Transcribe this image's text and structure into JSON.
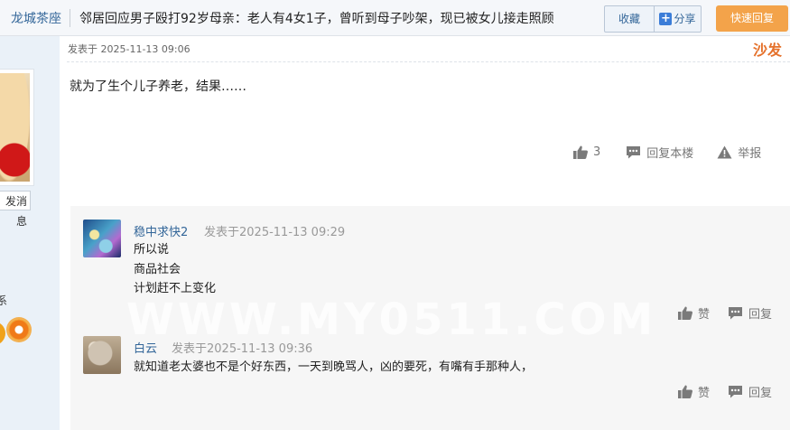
{
  "header": {
    "board_link": "龙城茶座",
    "thread_title": "邻居回应男子殴打92岁母亲：老人有4女1子，曾听到母子吵架，现已被女儿接走照顾",
    "favorite_label": "收藏",
    "share_label": "分享",
    "quick_reply_label": "快速回复"
  },
  "user_sidebar": {
    "message_button": "发消息",
    "text_fragment": "系"
  },
  "post": {
    "posted_at": "发表于 2025-11-13 09:06",
    "floor_label": "沙发",
    "body": "就为了生个儿子养老，结果……",
    "like_count": "3",
    "reply_label": "回复本楼",
    "report_label": "举报"
  },
  "comments": [
    {
      "username": "稳中求快2",
      "posted_at": "发表于2025-11-13 09:29",
      "lines": [
        "所以说",
        "商品社会",
        "计划赶不上变化"
      ],
      "like_label": "赞",
      "reply_label": "回复"
    },
    {
      "username": "白云",
      "posted_at": "发表于2025-11-13 09:36",
      "lines": [
        "就知道老太婆也不是个好东西，一天到晚骂人，凶的要死，有嘴有手那种人，"
      ],
      "like_label": "赞",
      "reply_label": "回复"
    }
  ],
  "watermark": "WWW.MY0511.COM",
  "colors": {
    "link": "#336699",
    "accent_orange": "#f3a34a",
    "floor_label": "#e5712b",
    "comment_bg": "#f6f6f6"
  }
}
